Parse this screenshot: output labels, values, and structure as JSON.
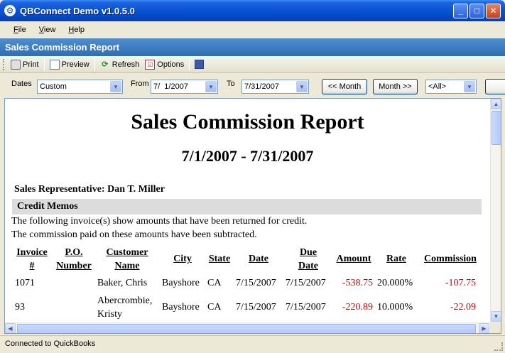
{
  "window": {
    "title": "QBConnect Demo v1.0.5.0",
    "icon": "gear-icon",
    "accent": "#0a55d6"
  },
  "menu": [
    {
      "label_u": "F",
      "label_rest": "ile"
    },
    {
      "label_u": "V",
      "label_rest": "iew"
    },
    {
      "label_u": "H",
      "label_rest": "elp"
    }
  ],
  "report_header": "Sales Commission Report",
  "toolbar": {
    "print": "Print",
    "preview": "Preview",
    "refresh": "Refresh",
    "options": "Options"
  },
  "filters": {
    "dates_label": "Dates",
    "dates_value": "Custom",
    "from_label": "From",
    "from_value": "7/  1/2007",
    "to_label": "To",
    "to_value": "7/31/2007",
    "prev_month": "<< Month",
    "next_month": "Month >>",
    "rep_value": "<All>"
  },
  "report": {
    "title": "Sales Commission Report",
    "date_range": "7/1/2007 - 7/31/2007",
    "rep_label": "Sales Representative:",
    "rep_name": "Dan T. Miller",
    "section": "Credit Memos",
    "note1": "The following invoice(s) show amounts that have been returned for credit.",
    "note2": "The commission paid on these amounts have been subtracted.",
    "columns": [
      {
        "l1": "Invoice",
        "l2": "#"
      },
      {
        "l1": "P.O.",
        "l2": "Number"
      },
      {
        "l1": "Customer",
        "l2": "Name"
      },
      {
        "l1": "City",
        "l2": ""
      },
      {
        "l1": "State",
        "l2": ""
      },
      {
        "l1": "Date",
        "l2": ""
      },
      {
        "l1": "Due",
        "l2": "Date"
      },
      {
        "l1": "Amount",
        "l2": ""
      },
      {
        "l1": "Rate",
        "l2": ""
      },
      {
        "l1": "Commission",
        "l2": ""
      }
    ],
    "rows": [
      {
        "invoice": "1071",
        "po": "",
        "customer_l1": "Baker, Chris",
        "customer_l2": "",
        "city": "Bayshore",
        "state": "CA",
        "date": "7/15/2007",
        "due": "7/15/2007",
        "amount": "-538.75",
        "rate": "20.000%",
        "commission": "-107.75"
      },
      {
        "invoice": "93",
        "po": "",
        "customer_l1": "Abercrombie,",
        "customer_l2": "Kristy",
        "city": "Bayshore",
        "state": "CA",
        "date": "7/15/2007",
        "due": "7/15/2007",
        "amount": "-220.89",
        "rate": "10.000%",
        "commission": "-22.09"
      }
    ],
    "negative_color": "#cc0000"
  },
  "status": "Connected to QuickBooks"
}
